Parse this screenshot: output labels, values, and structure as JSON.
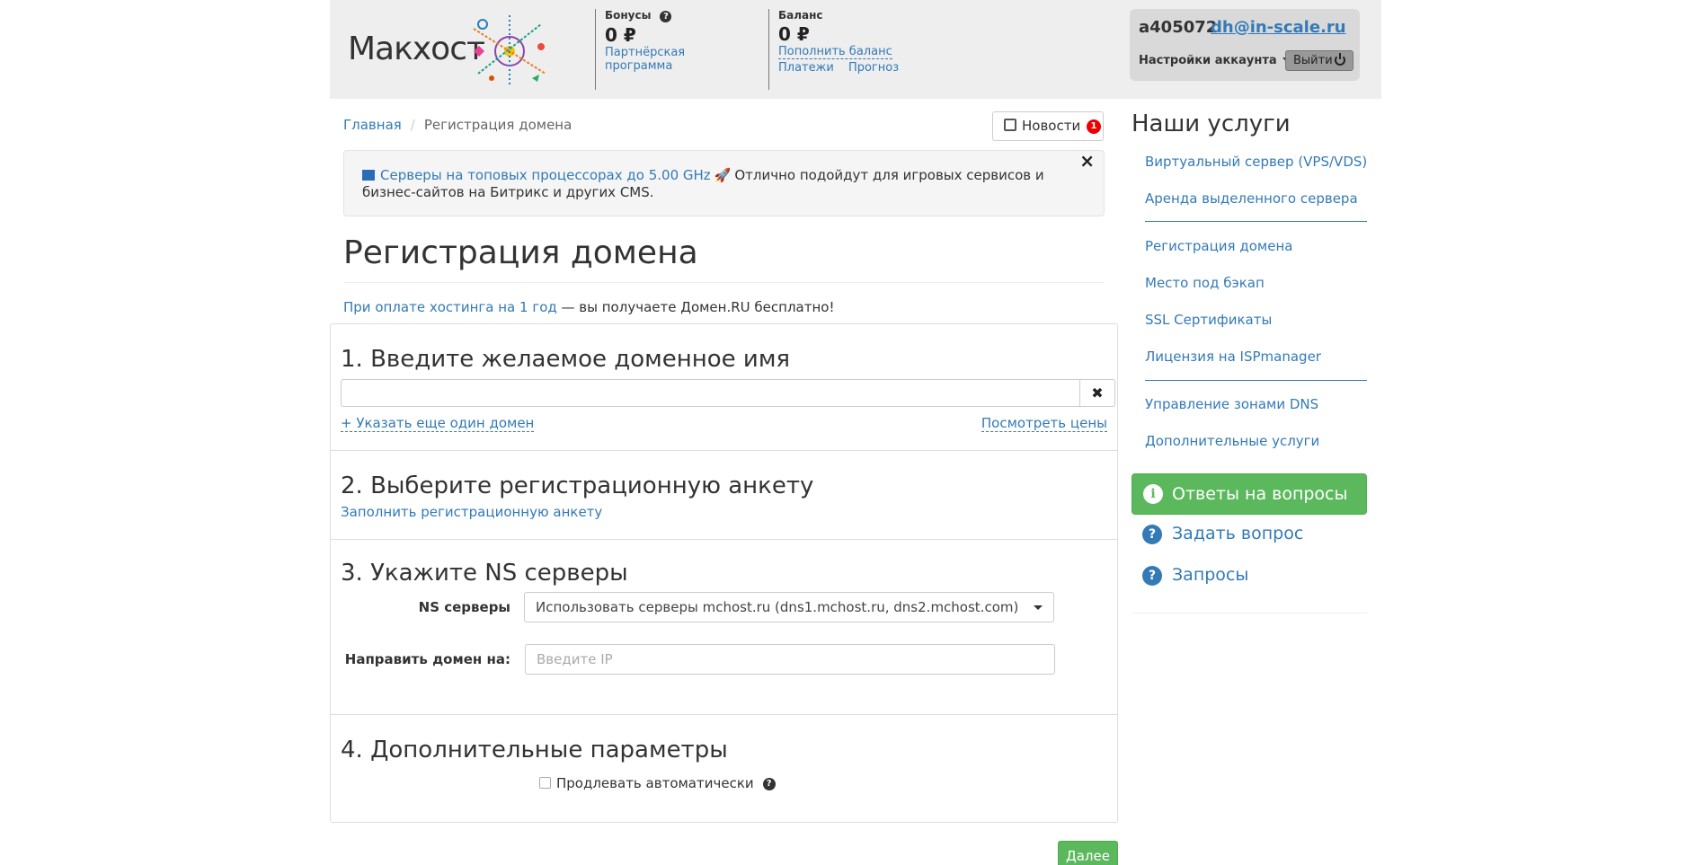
{
  "header": {
    "logo_text": "Макхост",
    "bonus": {
      "title": "Бонусы",
      "value": "0 ₽",
      "link": "Партнёрская программа"
    },
    "balance": {
      "title": "Баланс",
      "value": "0 ₽",
      "topup": "Пополнить баланс",
      "payments": "Платежи",
      "forecast": "Прогноз"
    },
    "account": {
      "id": "a405072",
      "email": "dh@in-scale.ru",
      "settings": "Настройки аккаунта",
      "logout": "Выйти"
    }
  },
  "breadcrumb": {
    "home": "Главная",
    "current": "Регистрация домена"
  },
  "news": {
    "label": "Новости",
    "count": "1"
  },
  "promo": {
    "link": "Серверы на топовых процессорах до 5.00 GHz",
    "text": "Отлично подойдут для игровых сервисов и бизнес-сайтов на Битрикс и других CMS."
  },
  "page_title": "Регистрация домена",
  "free_note": {
    "link": "При оплате хостинга на 1 год",
    "text": " — вы получаете Домен.RU бесплатно!"
  },
  "step1": {
    "title": "1. Введите желаемое доменное имя",
    "domain_value": "",
    "add_domain": "+ Указать еще один домен",
    "see_prices": "Посмотреть цены"
  },
  "step2": {
    "title": "2. Выберите регистрационную анкету",
    "link": "Заполнить регистрационную анкету"
  },
  "step3": {
    "title": "3. Укажите NS серверы",
    "ns_label": "NS серверы",
    "ns_value": "Использовать серверы mchost.ru (dns1.mchost.ru, dns2.mchost.com)",
    "point_label": "Направить домен на:",
    "ip_placeholder": "Введите IP"
  },
  "step4": {
    "title": "4. Дополнительные параметры",
    "auto_renew": "Продлевать автоматически"
  },
  "next_button": "Далее",
  "sidebar": {
    "title": "Наши услуги",
    "group1": [
      "Виртуальный сервер (VPS/VDS)",
      "Аренда выделенного сервера"
    ],
    "group2": [
      "Регистрация домена",
      "Место под бэкап",
      "SSL Сертификаты",
      "Лицензия на ISPmanager"
    ],
    "group3": [
      "Управление зонами DNS",
      "Дополнительные услуги"
    ],
    "faq": "Ответы на вопросы",
    "ask": "Задать вопрос",
    "requests": "Запросы"
  },
  "colors": {
    "link": "#337ab7",
    "success": "#5cb85c",
    "header_bg": "#eeeeee",
    "badge": "#e00000"
  }
}
